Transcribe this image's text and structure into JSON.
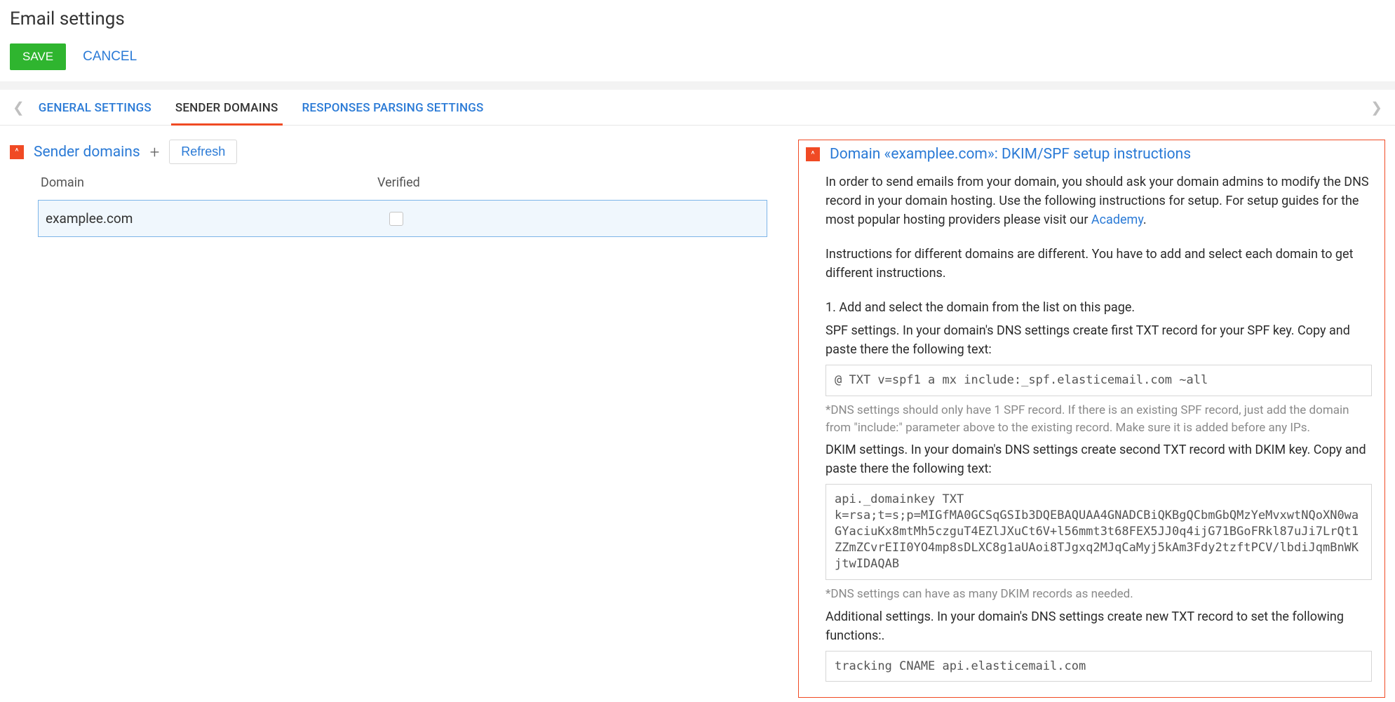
{
  "page": {
    "title": "Email settings"
  },
  "actions": {
    "save": "SAVE",
    "cancel": "CANCEL"
  },
  "tabs": {
    "general": "GENERAL SETTINGS",
    "sender": "SENDER DOMAINS",
    "responses": "RESPONSES PARSING SETTINGS"
  },
  "sender_domains": {
    "title": "Sender domains",
    "refresh": "Refresh",
    "columns": {
      "domain": "Domain",
      "verified": "Verified"
    },
    "rows": [
      {
        "domain": "examplee.com",
        "verified": false
      }
    ]
  },
  "setup": {
    "title": "Domain «examplee.com»: DKIM/SPF setup instructions",
    "intro1_pre": "In order to send emails from your domain, you should ask your domain admins to modify the DNS record in your domain hosting. Use the following instructions for setup. For setup guides for the most popular hosting providers please visit our ",
    "academy": "Academy",
    "intro1_post": ".",
    "intro2": "Instructions for different domains are different. You have to add and select each domain to get different instructions.",
    "step1": "1. Add and select the domain from the list on this page.",
    "spf_title": "SPF settings. In your domain's DNS settings create first TXT record for your SPF key. Copy and paste there the following text:",
    "spf_code": "@ TXT v=spf1 a mx include:_spf.elasticemail.com ~all",
    "spf_hint": "*DNS settings should only have 1 SPF record. If there is an existing SPF record, just add the domain from \"include:\" parameter above to the existing record. Make sure it is added before any IPs.",
    "dkim_title": "DKIM settings. In your domain's DNS settings create second TXT record with DKIM key. Copy and paste there the following text:",
    "dkim_code": "api._domainkey TXT\nk=rsa;t=s;p=MIGfMA0GCSqGSIb3DQEBAQUAA4GNADCBiQKBgQCbmGbQMzYeMvxwtNQoXN0waGYaciuKx8mtMh5czguT4EZlJXuCt6V+l56mmt3t68FEX5JJ0q4ijG71BGoFRkl87uJi7LrQt1ZZmZCvrEII0YO4mp8sDLXC8g1aUAoi8TJgxq2MJqCaMyj5kAm3Fdy2tzftPCV/lbdiJqmBnWKjtwIDAQAB",
    "dkim_hint": "*DNS settings can have as many DKIM records as needed.",
    "additional_title": "Additional settings. In your domain's DNS settings create new TXT record to set the following functions:.",
    "additional_code": "tracking CNAME api.elasticemail.com"
  }
}
